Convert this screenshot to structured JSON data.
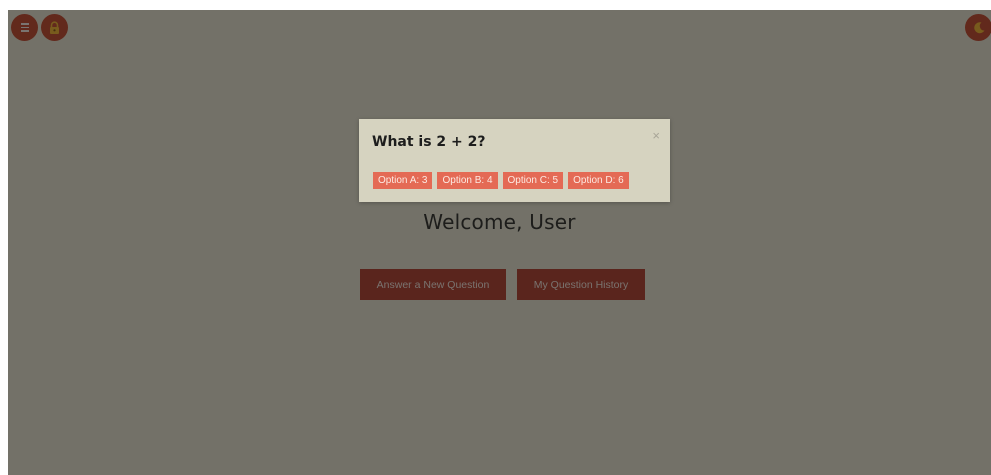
{
  "header": {
    "menu_icon": "hamburger-menu-icon",
    "lock_icon": "lock-icon",
    "theme_icon": "moon-icon"
  },
  "main": {
    "welcome_text": "Welcome, User",
    "answer_button_label": "Answer a New Question",
    "history_button_label": "My Question History"
  },
  "modal": {
    "question": "What is 2 + 2?",
    "close_label": "×",
    "options": [
      {
        "label": "Option A: 3"
      },
      {
        "label": "Option B: 4"
      },
      {
        "label": "Option C: 5"
      },
      {
        "label": "Option D: 6"
      }
    ]
  },
  "colors": {
    "page_background": "#e6e2d0",
    "primary_button": "#b44a3a",
    "option_button": "#e46a55",
    "circle_button": "#c45238",
    "modal_background": "#d6d3c0"
  }
}
